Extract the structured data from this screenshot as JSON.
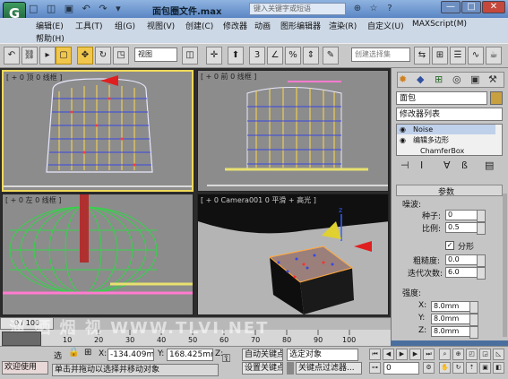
{
  "titlebar": {
    "app_icon": "3ds-max-logo-icon",
    "title": "面包圈文件.max",
    "search_placeholder": "键入关键字或短语",
    "quick_access_glyphs": "□ ◫ ▣ ↶ ↷ ▾",
    "minimize": "—",
    "maximize": "□",
    "close": "✕"
  },
  "menu": {
    "row1": [
      "编辑(E)",
      "工具(T)",
      "组(G)",
      "视图(V)",
      "创建(C)",
      "修改器",
      "动画",
      "图形编辑器",
      "渲染(R)",
      "自定义(U)",
      "MAXScript(M)"
    ],
    "row2": [
      "帮助(H)"
    ]
  },
  "toolbar": {
    "view_dropdown": "视图",
    "selection_set_placeholder": "创建选择集",
    "snap_number": "3",
    "percent_symbol": "%",
    "angle_snap": "∠"
  },
  "viewports": {
    "top_left": "[ + 0 顶 0 线框 ]",
    "top_right": "[ + 0 前 0 线框 ]",
    "bottom_left": "[ + 0 左 0 线框 ]",
    "bottom_right": "[ + 0 Camera001 0 平滑 + 高光 ]"
  },
  "command_panel": {
    "object_name": "面包",
    "modifier_list": "修改器列表",
    "stack": [
      "Noise",
      "编辑多边形",
      "ChamferBox"
    ],
    "rollout_title": "参数",
    "seed_group": "噪波:",
    "seed_label": "种子:",
    "seed_value": "0",
    "scale_label": "比例:",
    "scale_value": "0.5",
    "fractal_label": "分形",
    "fractal_checked": true,
    "roughness_label": "粗糙度:",
    "roughness_value": "0.0",
    "iterations_label": "迭代次数:",
    "iterations_value": "6.0",
    "strength_group": "强度:",
    "x_label": "X:",
    "x_value": "8.0mm",
    "y_label": "Y:",
    "y_value": "8.0mm",
    "z_label": "Z:",
    "z_value": "8.0mm"
  },
  "timeline": {
    "frame_display": "0 / 100",
    "ruler_ticks": [
      "0",
      "10",
      "20",
      "30",
      "40",
      "50",
      "60",
      "70",
      "80",
      "90",
      "100"
    ]
  },
  "status": {
    "welcome": "欢迎使用",
    "sel_label": "选",
    "x_label": "X:",
    "x_value": "-134.409m",
    "y_label": "Y:",
    "y_value": "168.425mr",
    "z_label": "Z:",
    "prompt": "单击并拖动以选择并移动对象",
    "auto_key": "自动关键点",
    "set_key": "设置关键点",
    "key_dropdown": "选定对象",
    "key_filters": "关键点过滤器...",
    "frame_value": "0"
  },
  "watermark": "溜 晒 烟 视 WWW.TLVI.NET",
  "colors": {
    "active_border": "#f0d95a",
    "viewport_bg": "#8c8c8c",
    "title_gradient_top": "#8fb3e0"
  }
}
